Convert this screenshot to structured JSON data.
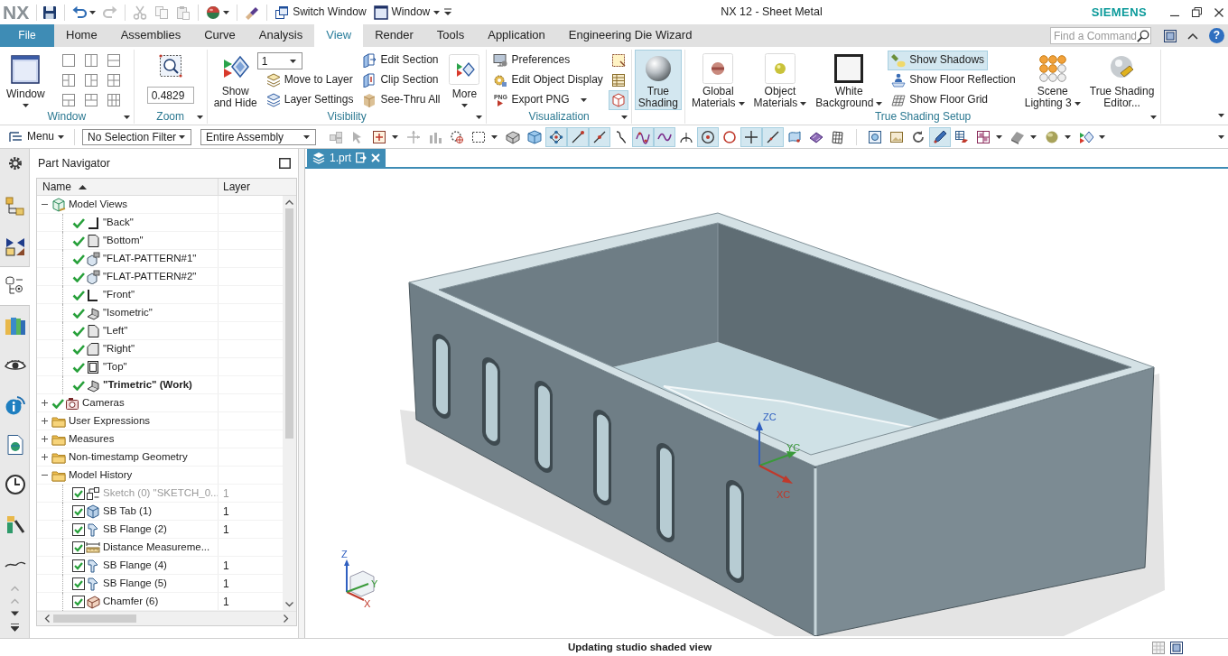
{
  "window": {
    "logo": "NX",
    "title": "NX 12 - Sheet Metal",
    "brand": "SIEMENS"
  },
  "quick_access": {
    "tools": [
      {
        "disabled": false,
        "has_menu": false
      },
      {
        "disabled": false,
        "has_menu": true
      },
      {
        "disabled": true,
        "has_menu": false
      },
      {
        "disabled": true,
        "has_menu": false
      },
      {
        "disabled": true,
        "has_menu": false
      },
      {
        "disabled": true,
        "has_menu": false
      },
      {
        "disabled": false,
        "has_menu": true
      },
      {
        "disabled": false,
        "has_menu": false
      }
    ],
    "switch_window": "Switch Window",
    "window_menu": "Window"
  },
  "tabs": [
    {
      "label": "File",
      "kind": "file",
      "selected": false
    },
    {
      "label": "Home",
      "kind": "tab",
      "selected": false
    },
    {
      "label": "Assemblies",
      "kind": "tab",
      "selected": false
    },
    {
      "label": "Curve",
      "kind": "tab",
      "selected": false
    },
    {
      "label": "Analysis",
      "kind": "tab",
      "selected": false
    },
    {
      "label": "View",
      "kind": "tab",
      "selected": true
    },
    {
      "label": "Render",
      "kind": "tab",
      "selected": false
    },
    {
      "label": "Tools",
      "kind": "tab",
      "selected": false
    },
    {
      "label": "Application",
      "kind": "tab",
      "selected": false
    },
    {
      "label": "Engineering Die Wizard",
      "kind": "tab",
      "selected": false
    }
  ],
  "command_search": {
    "placeholder": "Find a Command"
  },
  "help": "?",
  "ribbon": {
    "groups": [
      {
        "label": "Window",
        "launcher": true,
        "columns": [
          {
            "kind": "large",
            "label": "Window",
            "has_menu": true,
            "on": false
          },
          {
            "kind": "layouts"
          }
        ]
      },
      {
        "label": "Zoom",
        "launcher": true,
        "columns": [
          {
            "kind": "stack",
            "items": [
              {
                "kind": "icon",
                "on": false
              },
              {
                "kind": "number",
                "value": "0.4829"
              }
            ]
          }
        ]
      },
      {
        "label": "Visibility",
        "launcher": true,
        "columns": [
          {
            "kind": "large",
            "label": "Show\nand Hide",
            "has_menu": false,
            "on": false
          },
          {
            "kind": "stack",
            "items": [
              {
                "kind": "select",
                "value": "1"
              },
              {
                "kind": "small",
                "label": "Move to Layer",
                "has_menu": false,
                "on": false
              },
              {
                "kind": "small",
                "label": "Layer Settings",
                "has_menu": false,
                "on": false
              }
            ]
          },
          {
            "kind": "stack",
            "items": [
              {
                "kind": "small",
                "label": "Edit Section",
                "has_menu": false,
                "on": false
              },
              {
                "kind": "small",
                "label": "Clip Section",
                "has_menu": false,
                "on": false
              },
              {
                "kind": "small",
                "label": "See-Thru All",
                "has_menu": false,
                "on": false
              }
            ]
          },
          {
            "kind": "large",
            "label": "More",
            "has_menu": true,
            "on": false
          }
        ]
      },
      {
        "label": "Visualization",
        "launcher": true,
        "columns": [
          {
            "kind": "stack",
            "items": [
              {
                "kind": "small",
                "label": "Preferences",
                "has_menu": false,
                "on": false
              },
              {
                "kind": "small",
                "label": "Edit Object Display",
                "has_menu": false,
                "on": false
              },
              {
                "kind": "small",
                "label": "Export PNG",
                "icon_text": "PNG",
                "has_menu": true,
                "on": false
              }
            ]
          },
          {
            "kind": "stack",
            "items": [
              {
                "kind": "icon",
                "on": false
              },
              {
                "kind": "icon",
                "on": false
              },
              {
                "kind": "icon",
                "on": true
              }
            ]
          }
        ]
      },
      {
        "launcher": false,
        "columns": [
          {
            "kind": "large",
            "label": "True\nShading",
            "has_menu": false,
            "on": true
          }
        ]
      },
      {
        "label": "True Shading Setup",
        "launcher": true,
        "columns": [
          {
            "kind": "large",
            "label": "Global\nMaterials",
            "has_menu": true,
            "on": false
          },
          {
            "kind": "large",
            "label": "Object\nMaterials",
            "has_menu": true,
            "on": false
          },
          {
            "kind": "large",
            "label": "White\nBackground",
            "has_menu": true,
            "on": false
          },
          {
            "kind": "stack",
            "items": [
              {
                "kind": "small",
                "label": "Show Shadows",
                "has_menu": false,
                "on": true
              },
              {
                "kind": "small",
                "label": "Show Floor Reflection",
                "has_menu": false,
                "on": false
              },
              {
                "kind": "small",
                "label": "Show Floor Grid",
                "has_menu": false,
                "on": false
              }
            ]
          },
          {
            "kind": "large",
            "label": "Scene\nLighting 3",
            "has_menu": true,
            "on": false
          },
          {
            "kind": "large",
            "label": "True Shading\nEditor...",
            "has_menu": false,
            "on": false
          }
        ]
      }
    ]
  },
  "toolbar": {
    "menu": "Menu",
    "filters": [
      {
        "value": "No Selection Filter"
      },
      {
        "value": "Entire Assembly"
      }
    ],
    "tool_groups": [
      [
        {
          "on": false,
          "disabled": true,
          "has_menu": false
        },
        {
          "on": false,
          "disabled": true,
          "has_menu": false
        },
        {
          "on": false,
          "disabled": false,
          "has_menu": true
        },
        {
          "on": false,
          "disabled": true,
          "has_menu": false
        },
        {
          "on": false,
          "disabled": true,
          "has_menu": false
        },
        {
          "on": false,
          "disabled": false,
          "has_menu": false
        },
        {
          "on": false,
          "disabled": false,
          "has_menu": true
        },
        {
          "on": false,
          "disabled": false,
          "has_menu": false
        },
        {
          "on": false,
          "disabled": false,
          "has_menu": false
        },
        {
          "on": true,
          "disabled": false,
          "has_menu": false
        },
        {
          "on": true,
          "disabled": false,
          "has_menu": false
        },
        {
          "on": true,
          "disabled": false,
          "has_menu": false
        },
        {
          "on": false,
          "disabled": false,
          "has_menu": false
        },
        {
          "on": true,
          "disabled": false,
          "has_menu": false
        },
        {
          "on": true,
          "disabled": false,
          "has_menu": false
        },
        {
          "on": false,
          "disabled": false,
          "has_menu": false
        },
        {
          "on": true,
          "disabled": false,
          "has_menu": false
        },
        {
          "on": false,
          "disabled": false,
          "has_menu": false
        },
        {
          "on": true,
          "disabled": false,
          "has_menu": false
        },
        {
          "on": true,
          "disabled": false,
          "has_menu": false
        },
        {
          "on": false,
          "disabled": false,
          "has_menu": false
        },
        {
          "on": false,
          "disabled": false,
          "has_menu": false
        },
        {
          "on": false,
          "disabled": false,
          "has_menu": false
        }
      ],
      [
        {
          "on": false,
          "disabled": false,
          "has_menu": false
        },
        {
          "on": false,
          "disabled": false,
          "has_menu": false
        },
        {
          "on": false,
          "disabled": false,
          "has_menu": false
        },
        {
          "on": true,
          "disabled": false,
          "has_menu": false
        },
        {
          "on": false,
          "disabled": false,
          "has_menu": false
        },
        {
          "on": false,
          "disabled": false,
          "has_menu": true
        },
        {
          "on": false,
          "disabled": false,
          "has_menu": true
        },
        {
          "on": false,
          "disabled": false,
          "has_menu": true
        },
        {
          "on": false,
          "disabled": false,
          "has_menu": true
        }
      ]
    ]
  },
  "resource_bar": {
    "items": [
      {
        "selected": false
      },
      {
        "selected": false
      },
      {
        "selected": false
      },
      {
        "selected": true
      },
      {
        "selected": false
      },
      {
        "selected": false
      },
      {
        "selected": false
      },
      {
        "selected": false
      },
      {
        "selected": false
      },
      {
        "selected": false
      },
      {
        "selected": false
      }
    ]
  },
  "navigator": {
    "title": "Part Navigator",
    "columns": [
      {
        "label": "Name",
        "sorted": true
      },
      {
        "label": "Layer"
      }
    ],
    "tree": [
      {
        "label": "Model Views",
        "kind": "group",
        "expanded": true,
        "checked": false,
        "children": [
          {
            "label": "\"Back\"",
            "kind": "view",
            "checked": true,
            "work_view": false
          },
          {
            "label": "\"Bottom\"",
            "kind": "view",
            "checked": true,
            "work_view": false
          },
          {
            "label": "\"FLAT-PATTERN#1\"",
            "kind": "view",
            "checked": true,
            "work_view": false
          },
          {
            "label": "\"FLAT-PATTERN#2\"",
            "kind": "view",
            "checked": true,
            "work_view": false
          },
          {
            "label": "\"Front\"",
            "kind": "view",
            "checked": true,
            "work_view": false
          },
          {
            "label": "\"Isometric\"",
            "kind": "view",
            "checked": true,
            "work_view": false
          },
          {
            "label": "\"Left\"",
            "kind": "view",
            "checked": true,
            "work_view": false
          },
          {
            "label": "\"Right\"",
            "kind": "view",
            "checked": true,
            "work_view": false
          },
          {
            "label": "\"Top\"",
            "kind": "view",
            "checked": true,
            "work_view": false
          },
          {
            "label": "\"Trimetric\" (Work)",
            "kind": "view",
            "checked": true,
            "work_view": true
          }
        ]
      },
      {
        "label": "Cameras",
        "kind": "group",
        "expanded": false,
        "checked": true
      },
      {
        "label": "User Expressions",
        "kind": "folder",
        "expanded": false,
        "checked": false
      },
      {
        "label": "Measures",
        "kind": "folder",
        "expanded": false,
        "checked": false
      },
      {
        "label": "Non-timestamp Geometry",
        "kind": "folder",
        "expanded": false,
        "checked": false
      },
      {
        "label": "Model History",
        "kind": "folder",
        "expanded": true,
        "checked": false,
        "children": [
          {
            "label": "Sketch (0) \"SKETCH_0...",
            "kind": "feature",
            "checked": true,
            "disabled": true,
            "layer": "1"
          },
          {
            "label": "SB Tab (1)",
            "kind": "feature",
            "checked": true,
            "disabled": false,
            "layer": "1"
          },
          {
            "label": "SB Flange (2)",
            "kind": "feature",
            "checked": true,
            "disabled": false,
            "layer": "1"
          },
          {
            "label": "Distance Measureme...",
            "kind": "feature",
            "checked": true,
            "disabled": false
          },
          {
            "label": "SB Flange (4)",
            "kind": "feature",
            "checked": true,
            "disabled": false,
            "layer": "1"
          },
          {
            "label": "SB Flange (5)",
            "kind": "feature",
            "checked": true,
            "disabled": false,
            "layer": "1"
          },
          {
            "label": "Chamfer (6)",
            "kind": "feature",
            "checked": true,
            "disabled": false,
            "layer": "1"
          }
        ]
      }
    ]
  },
  "viewport": {
    "tabs": [
      {
        "label": "1.prt",
        "selected": true
      }
    ],
    "wcs_axes": [
      "ZC",
      "YC",
      "XC"
    ],
    "view_axes": [
      "Z",
      "Y",
      "X"
    ]
  },
  "status_bar": {
    "message": "Updating studio shaded view"
  }
}
